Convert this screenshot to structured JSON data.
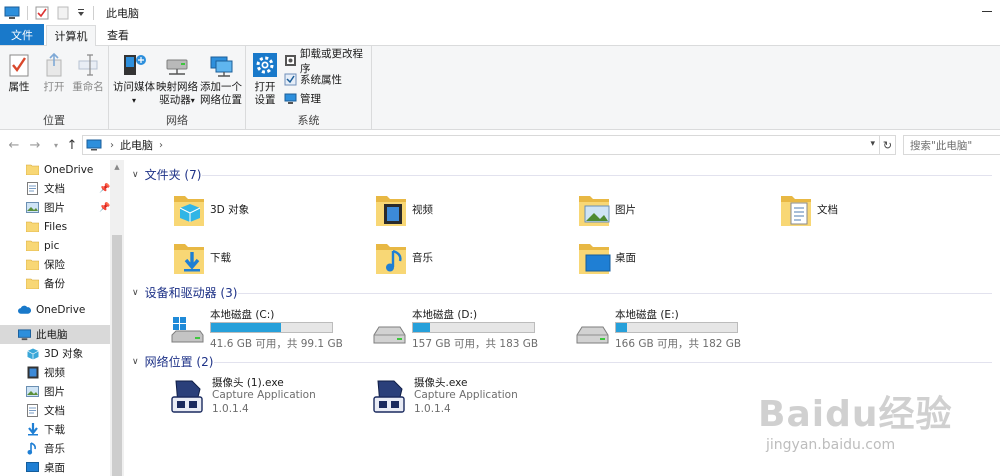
{
  "window": {
    "title": "此电脑"
  },
  "tabs": [
    {
      "label": "文件"
    },
    {
      "label": "计算机"
    },
    {
      "label": "查看"
    }
  ],
  "ribbon": {
    "location": {
      "label": "位置",
      "properties": "属性",
      "open": "打开",
      "rename": "重命名"
    },
    "network": {
      "label": "网络",
      "access_media": "访问媒体",
      "map_drive_1": "映射网络",
      "map_drive_2": "驱动器",
      "add_location_1": "添加一个",
      "add_location_2": "网络位置"
    },
    "system": {
      "label": "系统",
      "open_settings_1": "打开",
      "open_settings_2": "设置",
      "uninstall": "卸载或更改程序",
      "system_properties": "系统属性",
      "manage": "管理"
    }
  },
  "address": {
    "path": "此电脑",
    "search_placeholder": "搜索\"此电脑\""
  },
  "sidebar": {
    "items": [
      {
        "label": "OneDrive",
        "pinned": false
      },
      {
        "label": "文档",
        "pinned": true
      },
      {
        "label": "图片",
        "pinned": true
      },
      {
        "label": "Files",
        "pinned": false
      },
      {
        "label": "pic",
        "pinned": false
      },
      {
        "label": "保险",
        "pinned": false
      },
      {
        "label": "备份",
        "pinned": false
      },
      {
        "label": "OneDrive",
        "pinned": false
      },
      {
        "label": "此电脑",
        "pinned": false
      },
      {
        "label": "3D 对象",
        "pinned": false
      },
      {
        "label": "视频",
        "pinned": false
      },
      {
        "label": "图片",
        "pinned": false
      },
      {
        "label": "文档",
        "pinned": false
      },
      {
        "label": "下载",
        "pinned": false
      },
      {
        "label": "音乐",
        "pinned": false
      },
      {
        "label": "桌面",
        "pinned": false
      }
    ]
  },
  "sections": {
    "folders": {
      "title": "文件夹 (7)",
      "items": [
        "3D 对象",
        "视频",
        "图片",
        "文档",
        "下载",
        "音乐",
        "桌面"
      ]
    },
    "drives": {
      "title": "设备和驱动器 (3)",
      "items": [
        {
          "name": "本地磁盘 (C:)",
          "free": "41.6 GB 可用，共 99.1 GB",
          "used_fraction": 0.58
        },
        {
          "name": "本地磁盘 (D:)",
          "free": "157 GB 可用，共 183 GB",
          "used_fraction": 0.14
        },
        {
          "name": "本地磁盘 (E:)",
          "free": "166 GB 可用，共 182 GB",
          "used_fraction": 0.09
        }
      ]
    },
    "network": {
      "title": "网络位置 (2)",
      "items": [
        {
          "name": "摄像头 (1).exe",
          "desc": "Capture Application",
          "version": "1.0.1.4"
        },
        {
          "name": "摄像头.exe",
          "desc": "Capture Application",
          "version": "1.0.1.4"
        }
      ]
    }
  },
  "watermark": {
    "logo": "Baidu经验",
    "url": "jingyan.baidu.com"
  },
  "colors": {
    "accent": "#1979ca",
    "section": "#1e3287",
    "bar": "#26a0da",
    "folder": "#f8d775"
  }
}
